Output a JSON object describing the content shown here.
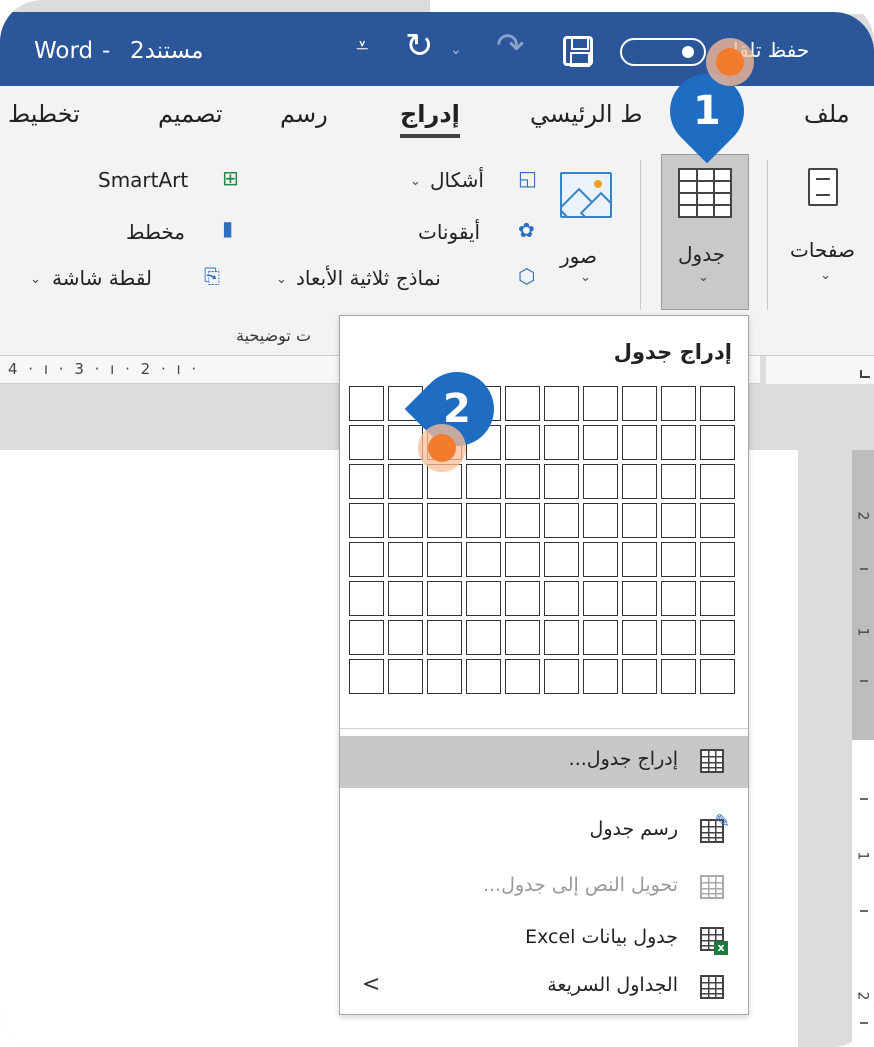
{
  "titlebar": {
    "app": "Word",
    "separator": "-",
    "document": "مستند2",
    "autosave_label": "حفظ تلقا",
    "save_icon": "save-icon",
    "undo_icon": "undo-icon",
    "redo_icon": "redo-icon"
  },
  "tabs": [
    "ملف",
    "ط الرئيسي",
    "إدراج",
    "رسم",
    "تصميم",
    "تخطيط"
  ],
  "ribbon": {
    "pages": "صفحات",
    "table": "جدول",
    "pictures": "صور",
    "shapes": "أشكال",
    "icons": "أيقونات",
    "models_3d": "نماذج ثلاثية الأبعاد",
    "smartart": "SmartArt",
    "chart": "مخطط",
    "screenshot": "لقطة شاشة",
    "group_label": "ت توضيحية"
  },
  "ruler": {
    "horizontal": "4 · ı · 3 · ı · 2 · ı ·",
    "vertical": [
      "2",
      "1",
      "1",
      "2"
    ]
  },
  "dropdown": {
    "title": "إدراج جدول",
    "grid": {
      "columns": 10,
      "rows": 8
    },
    "items": [
      {
        "label": "إدراج جدول...",
        "enabled": true,
        "highlighted": true
      },
      {
        "label": "رسم جدول",
        "enabled": true
      },
      {
        "label": "تحويل النص إلى جدول...",
        "enabled": false
      },
      {
        "label": "جدول بيانات Excel",
        "enabled": true
      },
      {
        "label": "الجداول السريعة",
        "enabled": true,
        "submenu": true
      }
    ]
  },
  "steps": [
    "1",
    "2"
  ],
  "chevron_down": "⌄",
  "chevron_left": "<",
  "glyphs": {
    "undo": "↻",
    "redo": "↷",
    "more": "⩡",
    "shapes": "◱",
    "icons": "✿",
    "models_3d": "⬡",
    "smartart": "⊞",
    "chart": "▮",
    "screenshot": "⎘"
  }
}
